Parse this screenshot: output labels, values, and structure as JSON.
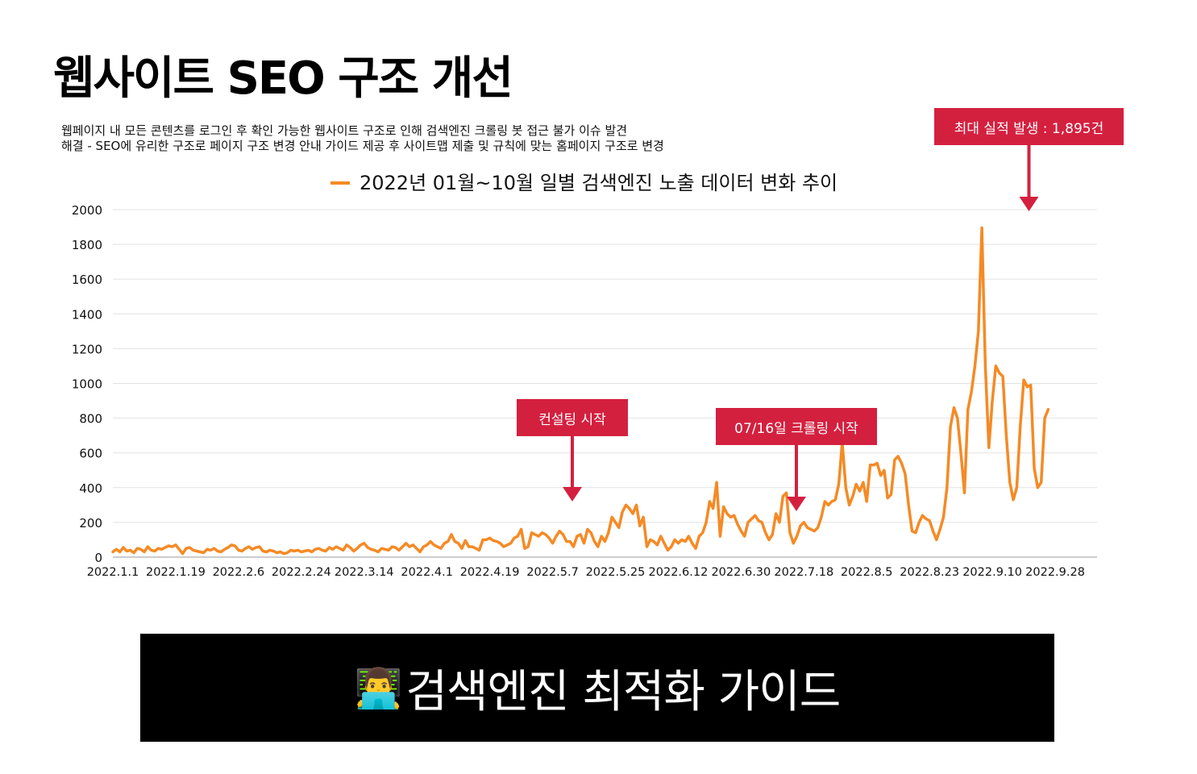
{
  "page": {
    "title": "웹사이트 SEO 구조 개선",
    "description": [
      "웹페이지 내 모든 콘텐츠를 로그인 후 확인 가능한 웹사이트 구조로 인해 검색엔진 크롤링 봇 접근 불가 이슈 발견",
      "해결 - SEO에 유리한 구조로 페이지 구조 변경 안내 가이드 제공 후 사이트맵 제출 및 규칙에 맞는 홈페이지 구조로 변경"
    ]
  },
  "annotations": [
    {
      "label": "컨설팅 시작",
      "date": "2022-05-10"
    },
    {
      "label": "07/16일 크롤링 시작",
      "date": "2022-07-16"
    },
    {
      "label": "최대 실적 발생 : 1,895건",
      "date": "2022-09-21"
    }
  ],
  "banner": {
    "icon": "👨‍💻",
    "icon_name": "technologist-icon",
    "text": "검색엔진 최적화 가이드"
  },
  "colors": {
    "line": "#f58a25",
    "callout": "#d4203f",
    "grid": "#e2e2e2",
    "banner_bg": "#000000"
  },
  "chart_data": {
    "type": "line",
    "legend": "2022년 01월~10월 일별 검색엔진 노출 데이터 변화 추이",
    "legend_position": "top",
    "ylim": [
      0,
      2000
    ],
    "yticks": [
      0,
      200,
      400,
      600,
      800,
      1000,
      1200,
      1400,
      1600,
      1800,
      2000
    ],
    "xtick_labels": [
      "2022.1.1",
      "2022.1.19",
      "2022.2.6",
      "2022.2.24",
      "2022.3.14",
      "2022.4.1",
      "2022.4.19",
      "2022.5.7",
      "2022.5.25",
      "2022.6.12",
      "2022.6.30",
      "2022.7.18",
      "2022.8.5",
      "2022.8.23",
      "2022.9.10",
      "2022.9.28"
    ],
    "x_start": "2022-01-01",
    "x_end": "2022-10-10",
    "grid": true,
    "series": [
      {
        "name": "2022년 01월~10월 일별 검색엔진 노출 데이터 변화 추이",
        "values": [
          [
            30,
            45,
            30,
            55,
            35,
            40,
            25,
            50,
            45,
            30,
            60,
            40,
            35,
            50,
            45,
            55,
            65,
            60,
            70,
            45,
            20,
            50,
            55,
            40,
            35,
            30,
            25,
            45,
            40,
            50,
            35,
            30,
            45,
            55,
            70,
            65,
            40,
            35,
            50,
            60,
            45,
            55,
            60,
            35,
            30,
            40,
            35,
            25,
            30,
            20,
            25,
            40,
            35,
            40,
            30,
            35,
            40,
            30,
            45,
            50,
            40,
            35,
            55,
            45,
            60,
            50,
            40,
            70,
            55,
            35,
            50,
            70,
            80,
            55,
            45,
            40,
            30,
            50,
            45,
            40,
            60,
            55,
            40,
            60,
            80,
            60,
            70,
            50,
            30,
            60,
            70,
            90,
            70,
            60,
            50,
            80,
            90,
            130,
            90,
            80,
            50,
            95,
            60,
            60,
            50,
            40,
            100,
            100,
            110,
            95,
            90,
            80,
            60,
            70,
            80,
            110,
            120,
            160,
            50,
            60,
            140,
            130,
            120,
            140,
            130,
            110,
            80,
            120,
            150,
            130,
            90,
            90,
            60,
            120,
            130,
            80,
            160,
            140,
            90,
            60,
            120,
            90,
            140,
            230,
            200,
            170,
            260,
            300,
            280,
            250,
            300,
            180,
            230,
            60,
            100,
            90,
            70,
            120,
            80,
            40,
            60,
            100,
            80,
            100,
            90,
            120,
            80,
            50,
            120,
            140,
            200,
            320,
            280,
            430,
            120,
            290,
            250,
            230,
            240,
            190,
            150,
            120,
            200,
            220,
            240,
            210,
            200,
            140,
            100,
            130,
            250,
            200,
            350,
            370,
            140,
            80,
            120,
            180,
            200,
            170,
            160,
            150,
            170,
            230,
            320,
            300,
            320,
            330,
            420,
            660,
            400,
            300,
            350,
            420,
            380,
            430,
            320,
            530,
            530,
            540,
            470,
            500,
            340,
            360,
            560,
            580,
            540,
            480,
            300,
            150,
            140,
            200,
            240,
            220,
            210,
            150,
            100,
            160,
            230,
            400,
            750,
            860,
            800,
            600,
            370,
            850,
            950,
            1100,
            1300,
            1895,
            1100,
            630,
            900,
            1100,
            1060,
            1040,
            700,
            430,
            330,
            400,
            750,
            1020,
            980,
            990,
            510,
            400,
            430,
            800,
            850
          ]
        ]
      }
    ]
  }
}
